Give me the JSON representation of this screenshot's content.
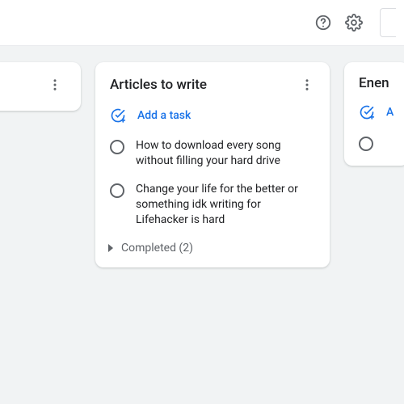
{
  "colors": {
    "accent": "#1a73e8",
    "icon": "#5f6368",
    "bg": "#f1f3f4"
  },
  "icons": {
    "help": "help-icon",
    "settings": "gear-icon",
    "more": "more-vert-icon",
    "add_task": "add-task-icon",
    "expand": "chevron-right-icon",
    "radio": "radio-unchecked-icon"
  },
  "lists": [
    {
      "title": ""
    },
    {
      "title": "Articles to write",
      "add_label": "Add a task",
      "tasks": [
        {
          "text": "How to download every song without filling your hard drive"
        },
        {
          "text": "Change your life for the better or something idk writing for Lifehacker is hard"
        }
      ],
      "completed_label": "Completed (2)"
    },
    {
      "title": "Enen",
      "add_label": "A",
      "tasks": [
        {
          "text": ""
        }
      ]
    }
  ]
}
